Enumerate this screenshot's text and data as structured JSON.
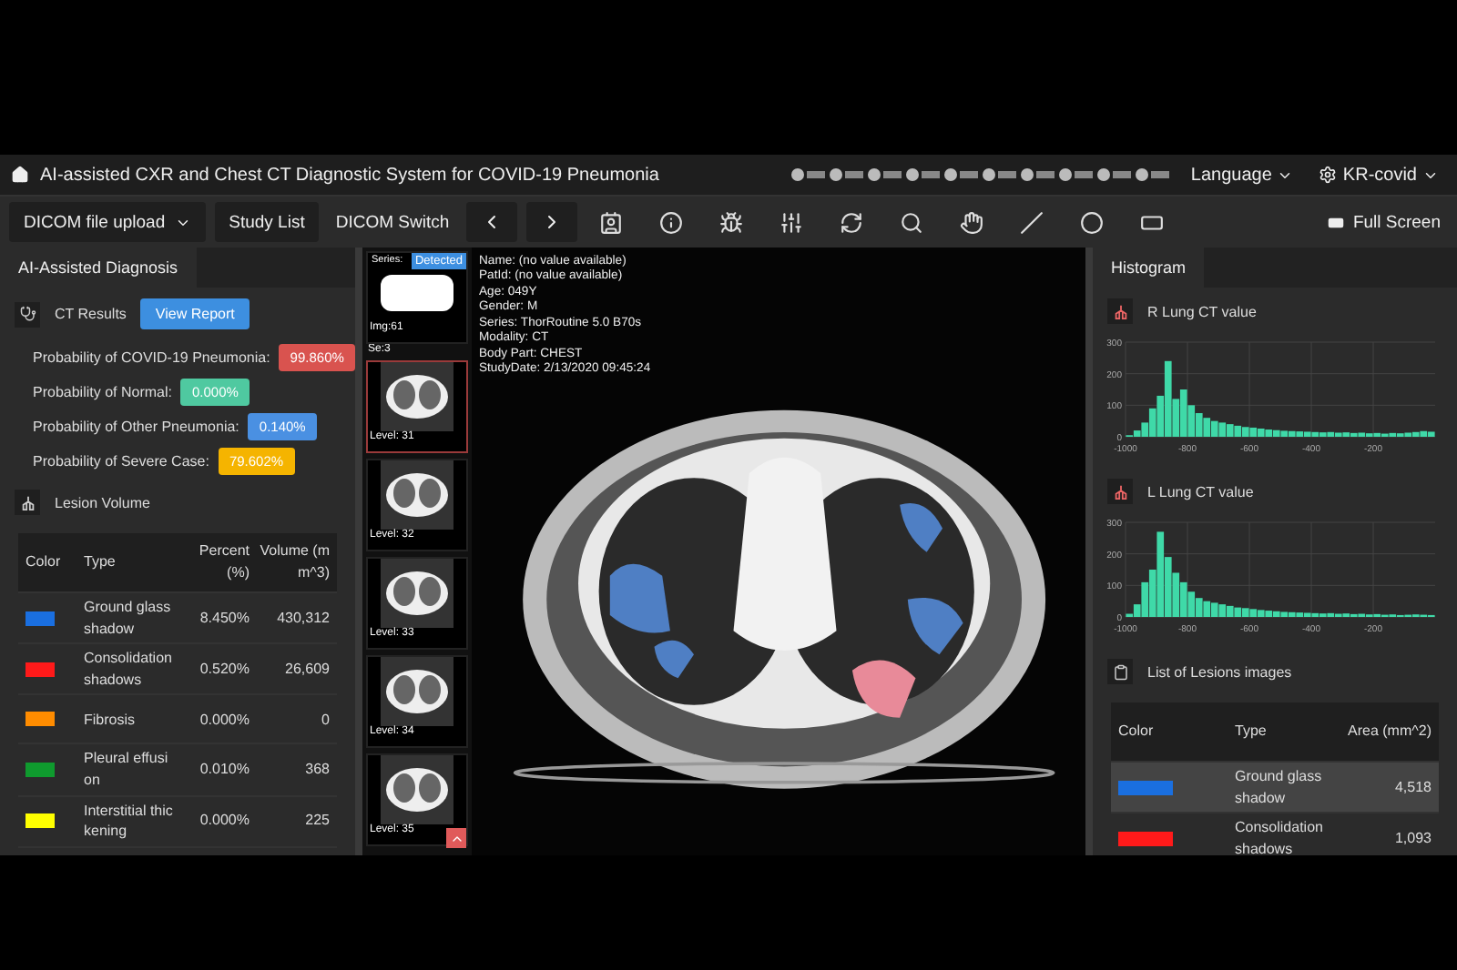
{
  "header": {
    "title": "AI-assisted CXR and Chest CT Diagnostic System for COVID-19 Pneumonia",
    "language": "Language",
    "user": "KR-covid"
  },
  "toolbar": {
    "upload": "DICOM file upload",
    "study_list": "Study List",
    "dicom_switch": "DICOM Switch",
    "full_screen": "Full Screen"
  },
  "left_panel": {
    "tab": "AI-Assisted Diagnosis",
    "ct_results": "CT Results",
    "view_report": "View Report",
    "probabilities": [
      {
        "label": "Probability of COVID-19 Pneumonia:",
        "value": "99.860%",
        "color": "#d9534f"
      },
      {
        "label": "Probability of Normal:",
        "value": "0.000%",
        "color": "#4fc9a0"
      },
      {
        "label": "Probability of Other Pneumonia:",
        "value": "0.140%",
        "color": "#4a90e2"
      },
      {
        "label": "Probability of Severe Case:",
        "value": "79.602%",
        "color": "#f5b400"
      }
    ],
    "lesion_volume": "Lesion Volume",
    "table": {
      "columns": [
        "Color",
        "Type",
        "Percent (%)",
        "Volume (mm^3)"
      ],
      "rows": [
        {
          "color": "#1a6fe0",
          "type": "Ground glass shadow",
          "percent": "8.450%",
          "volume": "430,312"
        },
        {
          "color": "#ff1a1a",
          "type": "Consolidation shadows",
          "percent": "0.520%",
          "volume": "26,609"
        },
        {
          "color": "#ff8c00",
          "type": "Fibrosis",
          "percent": "0.000%",
          "volume": "0"
        },
        {
          "color": "#0f9a2e",
          "type": "Pleural effusion",
          "percent": "0.010%",
          "volume": "368"
        },
        {
          "color": "#ffff00",
          "type": "Interstitial thickening",
          "percent": "0.000%",
          "volume": "225"
        }
      ]
    }
  },
  "thumbnails": {
    "series": {
      "label": "Series:",
      "badge": "Detected",
      "img": "Img:61",
      "se": "Se:3"
    },
    "levels": [
      {
        "label": "Level: 31",
        "selected": true
      },
      {
        "label": "Level: 32",
        "selected": false
      },
      {
        "label": "Level: 33",
        "selected": false
      },
      {
        "label": "Level: 34",
        "selected": false
      },
      {
        "label": "Level: 35",
        "selected": false
      }
    ]
  },
  "viewer": {
    "info": [
      "Name:  (no value available)",
      "PatId:  (no value available)",
      "Age:  049Y",
      "Gender:  M",
      "Series:  ThorRoutine 5.0 B70s",
      "Modality:  CT",
      "Body Part:  CHEST",
      "StudyDate:  2/13/2020 09:45:24"
    ]
  },
  "right_panel": {
    "tab": "Histogram",
    "r_lung": {
      "title": "R Lung CT value",
      "chart_data": {
        "type": "bar",
        "x": [
          -987.5,
          -962.5,
          -937.5,
          -912.5,
          -887.5,
          -862.5,
          -837.5,
          -812.5,
          -787.5,
          -762.5,
          -737.5,
          -712.5,
          -687.5,
          -662.5,
          -637.5,
          -612.5,
          -587.5,
          -562.5,
          -537.5,
          -512.5,
          -487.5,
          -462.5,
          -437.5,
          -412.5,
          -387.5,
          -362.5,
          -337.5,
          -312.5,
          -287.5,
          -262.5,
          -237.5,
          -212.5,
          -187.5,
          -162.5,
          -137.5,
          -112.5,
          -87.5,
          -62.5,
          -37.5,
          -12.5
        ],
        "values": [
          5,
          20,
          45,
          90,
          130,
          240,
          120,
          150,
          100,
          75,
          60,
          50,
          45,
          40,
          35,
          31,
          29,
          26,
          23,
          21,
          19,
          18,
          17,
          16,
          15,
          14,
          15,
          13,
          14,
          12,
          13,
          11,
          12,
          10,
          12,
          11,
          13,
          15,
          18,
          16
        ],
        "grid": true,
        "xlim": [
          -1000,
          0
        ],
        "ylim": [
          0,
          300
        ],
        "xticks": [
          -1000,
          -800,
          -600,
          -400,
          -200
        ],
        "yticks": [
          0,
          100,
          200,
          300
        ]
      }
    },
    "l_lung": {
      "title": "L Lung CT value",
      "chart_data": {
        "type": "bar",
        "x": [
          -987.5,
          -962.5,
          -937.5,
          -912.5,
          -887.5,
          -862.5,
          -837.5,
          -812.5,
          -787.5,
          -762.5,
          -737.5,
          -712.5,
          -687.5,
          -662.5,
          -637.5,
          -612.5,
          -587.5,
          -562.5,
          -537.5,
          -512.5,
          -487.5,
          -462.5,
          -437.5,
          -412.5,
          -387.5,
          -362.5,
          -337.5,
          -312.5,
          -287.5,
          -262.5,
          -237.5,
          -212.5,
          -187.5,
          -162.5,
          -137.5,
          -112.5,
          -87.5,
          -62.5,
          -37.5,
          -12.5
        ],
        "values": [
          10,
          40,
          110,
          150,
          270,
          190,
          140,
          110,
          80,
          60,
          50,
          45,
          40,
          35,
          30,
          28,
          25,
          22,
          20,
          18,
          16,
          15,
          14,
          13,
          12,
          11,
          12,
          10,
          11,
          9,
          10,
          8,
          9,
          7,
          8,
          6,
          7,
          8,
          7,
          6
        ],
        "grid": true,
        "xlim": [
          -1000,
          0
        ],
        "ylim": [
          0,
          300
        ],
        "xticks": [
          -1000,
          -800,
          -600,
          -400,
          -200
        ],
        "yticks": [
          0,
          100,
          200,
          300
        ]
      }
    },
    "lesion_list": {
      "title": "List of Lesions images",
      "columns": [
        "Color",
        "Type",
        "Area (mm^2)"
      ],
      "rows": [
        {
          "color": "#1a6fe0",
          "type": "Ground glass shadow",
          "area": "4,518",
          "selected": true
        },
        {
          "color": "#ff1a1a",
          "type": "Consolidation shadows",
          "area": "1,093",
          "selected": false
        }
      ]
    }
  }
}
